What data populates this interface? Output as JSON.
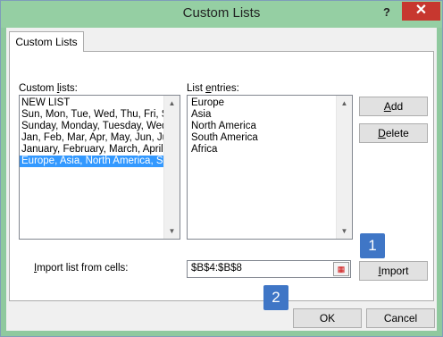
{
  "window": {
    "title": "Custom Lists",
    "help_label": "?",
    "close_label": "✕"
  },
  "tab": {
    "label": "Custom Lists"
  },
  "custom_lists": {
    "label_pre": "Custom ",
    "label_key": "l",
    "label_post": "ists:",
    "items": [
      "NEW LIST",
      "Sun, Mon, Tue, Wed, Thu, Fri, Sat",
      "Sunday, Monday, Tuesday, Wednesday, Thursday, Friday, Saturday",
      "Jan, Feb, Mar, Apr, May, Jun, Jul, Aug, Sep, Oct, Nov, Dec",
      "January, February, March, April, May, June, July, August, September, October, November, December",
      "Europe, Asia, North America, South America, Africa"
    ],
    "selected_index": 5
  },
  "list_entries": {
    "label_pre": "List ",
    "label_key": "e",
    "label_post": "ntries:",
    "items": [
      "Europe",
      "Asia",
      "North America",
      "South America",
      "Africa"
    ]
  },
  "buttons": {
    "add_key": "A",
    "add_rest": "dd",
    "delete_key": "D",
    "delete_rest": "elete",
    "import_key": "I",
    "import_rest": "mport",
    "ok_label": "OK",
    "cancel_label": "Cancel"
  },
  "import_row": {
    "label_key": "I",
    "label_rest": "mport list from cells:",
    "value": "$B$4:$B$8"
  },
  "badges": {
    "one": "1",
    "two": "2"
  },
  "colors": {
    "title_bar": "#95cfa3",
    "selection": "#3399ff",
    "badge": "#3f76c6",
    "close": "#c7372f"
  }
}
